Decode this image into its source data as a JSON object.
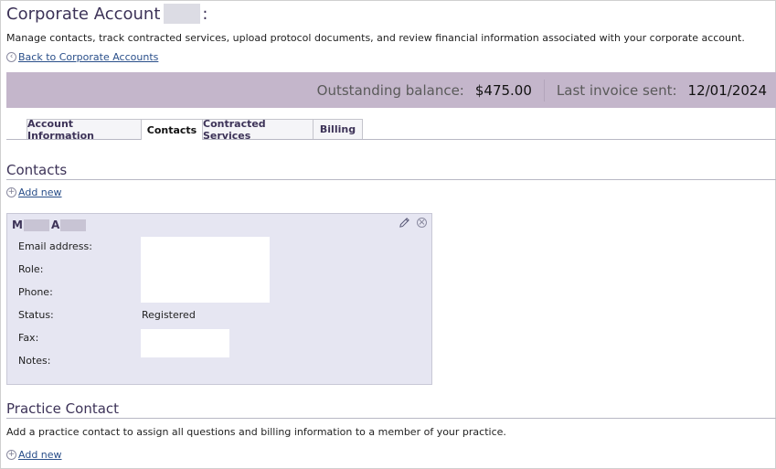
{
  "header": {
    "title": "Corporate Account",
    "title_suffix": ":",
    "description": "Manage contacts, track contracted services, upload protocol documents, and review financial information associated with your corporate account.",
    "back_link": "Back to Corporate Accounts"
  },
  "balance": {
    "outstanding_label": "Outstanding balance:",
    "outstanding_value": "$475.00",
    "invoice_label": "Last invoice sent:",
    "invoice_value": "12/01/2024"
  },
  "tabs": [
    {
      "label": "Account Information"
    },
    {
      "label": "Contacts"
    },
    {
      "label": "Contracted Services"
    },
    {
      "label": "Billing"
    }
  ],
  "contacts": {
    "heading": "Contacts",
    "add_label": "Add new",
    "card": {
      "name_initial_1": "M",
      "name_initial_2": "A",
      "fields": [
        {
          "label": "Email address:"
        },
        {
          "label": "Role:"
        },
        {
          "label": "Phone:"
        },
        {
          "label": "Status:",
          "value": "Registered"
        },
        {
          "label": "Fax:"
        },
        {
          "label": "Notes:"
        }
      ]
    }
  },
  "practice": {
    "heading": "Practice Contact",
    "description": "Add a practice contact to assign all questions and billing information to a member of your practice.",
    "add_label": "Add new"
  },
  "icons": {
    "back": "chevron-left-circle-icon",
    "add": "plus-circle-icon",
    "edit": "pencil-icon",
    "delete": "close-circle-icon"
  },
  "colors": {
    "accent": "#3d3358",
    "balance_bar": "#c4b6cb",
    "card_bg": "#e6e6f2",
    "link": "#2a4f8a"
  }
}
